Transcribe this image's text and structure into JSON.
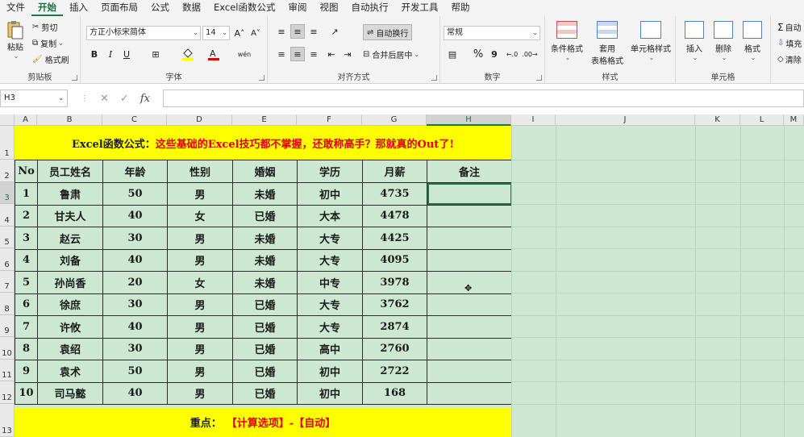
{
  "tabs": [
    "文件",
    "开始",
    "插入",
    "页面布局",
    "公式",
    "数据",
    "Excel函数公式",
    "审阅",
    "视图",
    "自动执行",
    "开发工具",
    "帮助"
  ],
  "active_tab_index": 1,
  "ribbon": {
    "clipboard": {
      "label": "剪贴板",
      "paste": "粘贴",
      "cut": "剪切",
      "copy": "复制",
      "format_painter": "格式刷"
    },
    "font": {
      "label": "字体",
      "font_name": "方正小标宋简体",
      "font_size": "14",
      "bold": "B",
      "italic": "I",
      "underline": "U"
    },
    "align": {
      "label": "对齐方式",
      "wrap": "自动换行",
      "merge": "合并后居中"
    },
    "number": {
      "label": "数字",
      "format": "常规",
      "percent": "%",
      "comma": "9"
    },
    "styles": {
      "label": "样式",
      "cond_format": "条件格式",
      "table_format_1": "套用",
      "table_format_2": "表格格式",
      "cell_style": "单元格样式"
    },
    "cells": {
      "label": "单元格",
      "insert": "插入",
      "delete": "删除",
      "format": "格式"
    },
    "editing": {
      "sum": "自动",
      "fill": "填充",
      "clear": "清除"
    }
  },
  "formula_bar": {
    "name_box": "H3",
    "cancel": "✕",
    "enter": "✓",
    "fx": "fx",
    "value": ""
  },
  "columns": [
    "A",
    "B",
    "C",
    "D",
    "E",
    "F",
    "G",
    "H",
    "I",
    "J",
    "K",
    "L",
    "M"
  ],
  "selected_column": "H",
  "rows": [
    "1",
    "2",
    "3",
    "4",
    "5",
    "6",
    "7",
    "8",
    "9",
    "10",
    "11",
    "12",
    "13"
  ],
  "selected_row": "3",
  "sheet": {
    "banner_black": "Excel函数公式：",
    "banner_red": "这些基础的Excel技巧都不掌握，还敢称高手？那就真的Out了!",
    "headers": [
      "No",
      "员工姓名",
      "年龄",
      "性别",
      "婚姻",
      "学历",
      "月薪",
      "备注"
    ],
    "records": [
      [
        "1",
        "鲁肃",
        "50",
        "男",
        "未婚",
        "初中",
        "4735",
        ""
      ],
      [
        "2",
        "甘夫人",
        "40",
        "女",
        "已婚",
        "大本",
        "4478",
        ""
      ],
      [
        "3",
        "赵云",
        "30",
        "男",
        "未婚",
        "大专",
        "4425",
        ""
      ],
      [
        "4",
        "刘备",
        "40",
        "男",
        "未婚",
        "大专",
        "4095",
        ""
      ],
      [
        "5",
        "孙尚香",
        "20",
        "女",
        "未婚",
        "中专",
        "3978",
        ""
      ],
      [
        "6",
        "徐庶",
        "30",
        "男",
        "已婚",
        "大专",
        "3762",
        ""
      ],
      [
        "7",
        "许攸",
        "40",
        "男",
        "已婚",
        "大专",
        "2874",
        ""
      ],
      [
        "8",
        "袁绍",
        "30",
        "男",
        "已婚",
        "高中",
        "2760",
        ""
      ],
      [
        "9",
        "袁术",
        "50",
        "男",
        "已婚",
        "初中",
        "2722",
        ""
      ],
      [
        "10",
        "司马懿",
        "40",
        "男",
        "已婚",
        "初中",
        "168",
        ""
      ]
    ],
    "footer_black": "重点：",
    "footer_red": "【计算选项】-【自动】"
  }
}
